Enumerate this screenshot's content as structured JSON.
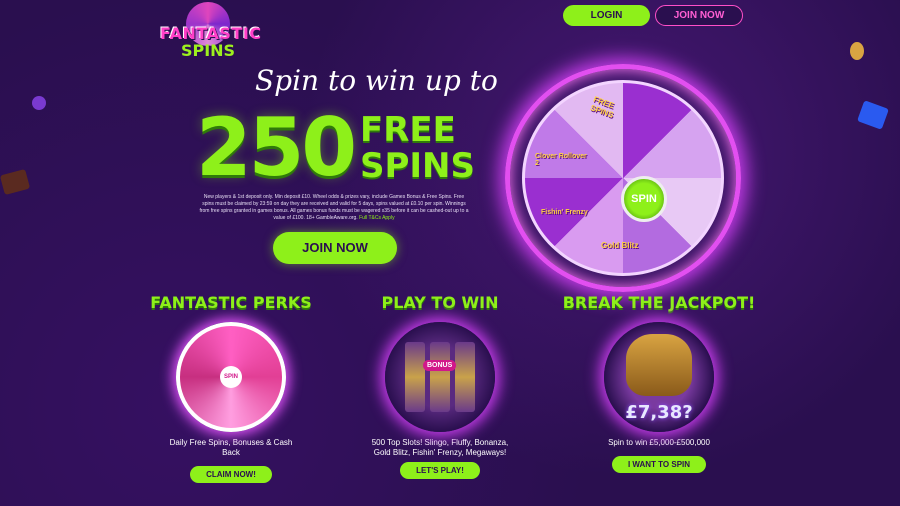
{
  "header": {
    "logo_line1": "FANTASTIC",
    "logo_line2": "SPINS",
    "login_label": "LOGIN",
    "join_label": "JOIN NOW"
  },
  "hero": {
    "headline": "Spin to win up to",
    "big_number": "250",
    "free_label": "FREE",
    "spins_label": "SPINS",
    "terms": "New players & 1st deposit only. Min deposit £10. Wheel odds & prizes vary, include Games Bonus & Free Spins. Free spins must be claimed by 23:59 on day they are received and valid for 5 days, spins valued at £0.10 per spin. Winnings from free spins granted in games bonus. All games bonus funds must be wagered x35 before it can be cashed-out up to a value of £100. 18+ GambleAware.org.",
    "terms_link": "Full T&Cs Apply",
    "join_cta": "JOIN NOW"
  },
  "wheel": {
    "center_label": "SPIN",
    "segments": [
      "FREE SPINS",
      "Clover Rollover 2",
      "Gold Blitz",
      "Fishin' Frenzy"
    ]
  },
  "columns": [
    {
      "title": "FANTASTIC PERKS",
      "desc": "Daily Free Spins, Bonuses & Cash Back",
      "cta": "CLAIM NOW!",
      "wheel_center": "SPIN"
    },
    {
      "title": "PLAY TO WIN",
      "desc": "500 Top Slots! Slingo, Fluffy, Bonanza, Gold Blitz, Fishin' Frenzy, Megaways!",
      "cta": "LET'S PLAY!",
      "badge": "BONUS"
    },
    {
      "title": "BREAK THE JACKPOT!",
      "desc": "Spin to win £5,000-£500,000",
      "cta": "I WANT TO SPIN",
      "amount": "£7,38?"
    }
  ],
  "colors": {
    "background": "#2a0f4f",
    "accent": "#8ef01a",
    "pink": "#ff4fc8"
  }
}
